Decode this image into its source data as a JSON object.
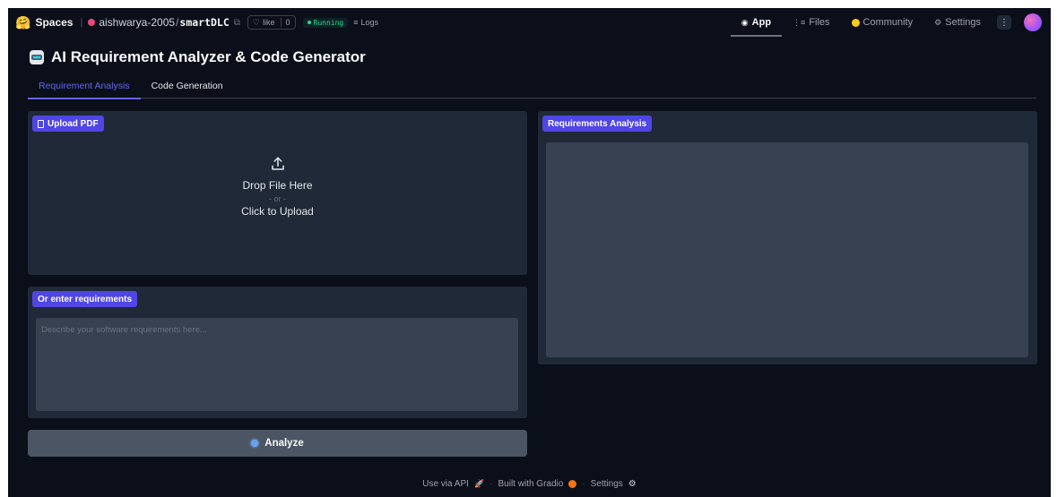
{
  "topbar": {
    "spaces_label": "Spaces",
    "owner": "aishwarya-2005",
    "repo": "smartDLC",
    "like_label": "like",
    "like_count": "0",
    "status": "Running",
    "logs_label": "Logs",
    "nav": {
      "app": "App",
      "files": "Files",
      "community": "Community",
      "settings": "Settings",
      "more": "⋮"
    }
  },
  "app": {
    "title": "AI Requirement Analyzer & Code Generator",
    "tabs": [
      {
        "label": "Requirement Analysis",
        "active": true
      },
      {
        "label": "Code Generation",
        "active": false
      }
    ]
  },
  "upload": {
    "label": "Upload PDF",
    "drop_text": "Drop File Here",
    "or_text": "- or -",
    "click_text": "Click to Upload"
  },
  "requirements": {
    "label": "Or enter requirements",
    "placeholder": "Describe your software requirements here...",
    "value": ""
  },
  "analyze_button": {
    "label": "Analyze"
  },
  "analysis": {
    "label": "Requirements Analysis",
    "output": ""
  },
  "footer": {
    "api": "Use via API",
    "built": "Built with Gradio",
    "settings": "Settings"
  },
  "colors": {
    "background": "#0b0f19",
    "panel": "#1f2937",
    "accent": "#4f46e5",
    "input": "#374151",
    "running": "#34d399"
  }
}
